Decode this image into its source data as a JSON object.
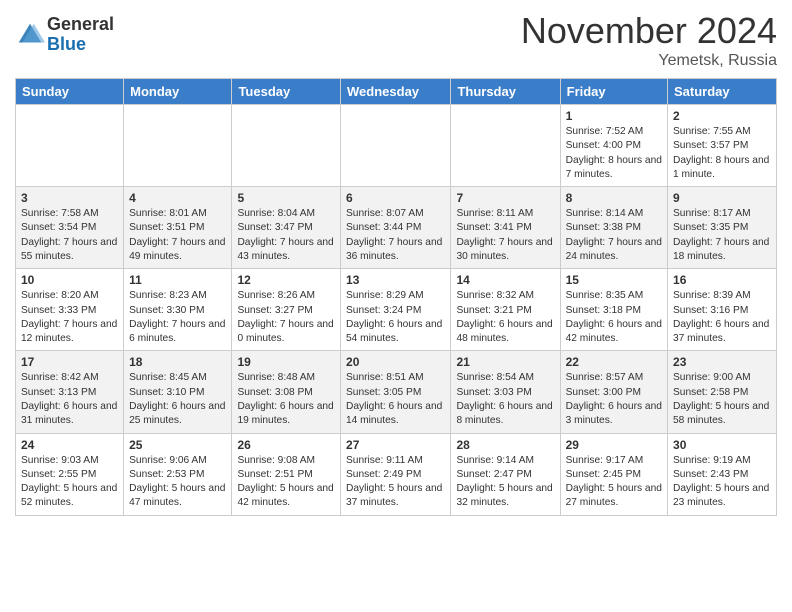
{
  "header": {
    "logo_general": "General",
    "logo_blue": "Blue",
    "month_title": "November 2024",
    "location": "Yemetsk, Russia"
  },
  "days_of_week": [
    "Sunday",
    "Monday",
    "Tuesday",
    "Wednesday",
    "Thursday",
    "Friday",
    "Saturday"
  ],
  "weeks": [
    [
      {
        "day": "",
        "sunrise": "",
        "sunset": "",
        "daylight": ""
      },
      {
        "day": "",
        "sunrise": "",
        "sunset": "",
        "daylight": ""
      },
      {
        "day": "",
        "sunrise": "",
        "sunset": "",
        "daylight": ""
      },
      {
        "day": "",
        "sunrise": "",
        "sunset": "",
        "daylight": ""
      },
      {
        "day": "",
        "sunrise": "",
        "sunset": "",
        "daylight": ""
      },
      {
        "day": "1",
        "sunrise": "Sunrise: 7:52 AM",
        "sunset": "Sunset: 4:00 PM",
        "daylight": "Daylight: 8 hours and 7 minutes."
      },
      {
        "day": "2",
        "sunrise": "Sunrise: 7:55 AM",
        "sunset": "Sunset: 3:57 PM",
        "daylight": "Daylight: 8 hours and 1 minute."
      }
    ],
    [
      {
        "day": "3",
        "sunrise": "Sunrise: 7:58 AM",
        "sunset": "Sunset: 3:54 PM",
        "daylight": "Daylight: 7 hours and 55 minutes."
      },
      {
        "day": "4",
        "sunrise": "Sunrise: 8:01 AM",
        "sunset": "Sunset: 3:51 PM",
        "daylight": "Daylight: 7 hours and 49 minutes."
      },
      {
        "day": "5",
        "sunrise": "Sunrise: 8:04 AM",
        "sunset": "Sunset: 3:47 PM",
        "daylight": "Daylight: 7 hours and 43 minutes."
      },
      {
        "day": "6",
        "sunrise": "Sunrise: 8:07 AM",
        "sunset": "Sunset: 3:44 PM",
        "daylight": "Daylight: 7 hours and 36 minutes."
      },
      {
        "day": "7",
        "sunrise": "Sunrise: 8:11 AM",
        "sunset": "Sunset: 3:41 PM",
        "daylight": "Daylight: 7 hours and 30 minutes."
      },
      {
        "day": "8",
        "sunrise": "Sunrise: 8:14 AM",
        "sunset": "Sunset: 3:38 PM",
        "daylight": "Daylight: 7 hours and 24 minutes."
      },
      {
        "day": "9",
        "sunrise": "Sunrise: 8:17 AM",
        "sunset": "Sunset: 3:35 PM",
        "daylight": "Daylight: 7 hours and 18 minutes."
      }
    ],
    [
      {
        "day": "10",
        "sunrise": "Sunrise: 8:20 AM",
        "sunset": "Sunset: 3:33 PM",
        "daylight": "Daylight: 7 hours and 12 minutes."
      },
      {
        "day": "11",
        "sunrise": "Sunrise: 8:23 AM",
        "sunset": "Sunset: 3:30 PM",
        "daylight": "Daylight: 7 hours and 6 minutes."
      },
      {
        "day": "12",
        "sunrise": "Sunrise: 8:26 AM",
        "sunset": "Sunset: 3:27 PM",
        "daylight": "Daylight: 7 hours and 0 minutes."
      },
      {
        "day": "13",
        "sunrise": "Sunrise: 8:29 AM",
        "sunset": "Sunset: 3:24 PM",
        "daylight": "Daylight: 6 hours and 54 minutes."
      },
      {
        "day": "14",
        "sunrise": "Sunrise: 8:32 AM",
        "sunset": "Sunset: 3:21 PM",
        "daylight": "Daylight: 6 hours and 48 minutes."
      },
      {
        "day": "15",
        "sunrise": "Sunrise: 8:35 AM",
        "sunset": "Sunset: 3:18 PM",
        "daylight": "Daylight: 6 hours and 42 minutes."
      },
      {
        "day": "16",
        "sunrise": "Sunrise: 8:39 AM",
        "sunset": "Sunset: 3:16 PM",
        "daylight": "Daylight: 6 hours and 37 minutes."
      }
    ],
    [
      {
        "day": "17",
        "sunrise": "Sunrise: 8:42 AM",
        "sunset": "Sunset: 3:13 PM",
        "daylight": "Daylight: 6 hours and 31 minutes."
      },
      {
        "day": "18",
        "sunrise": "Sunrise: 8:45 AM",
        "sunset": "Sunset: 3:10 PM",
        "daylight": "Daylight: 6 hours and 25 minutes."
      },
      {
        "day": "19",
        "sunrise": "Sunrise: 8:48 AM",
        "sunset": "Sunset: 3:08 PM",
        "daylight": "Daylight: 6 hours and 19 minutes."
      },
      {
        "day": "20",
        "sunrise": "Sunrise: 8:51 AM",
        "sunset": "Sunset: 3:05 PM",
        "daylight": "Daylight: 6 hours and 14 minutes."
      },
      {
        "day": "21",
        "sunrise": "Sunrise: 8:54 AM",
        "sunset": "Sunset: 3:03 PM",
        "daylight": "Daylight: 6 hours and 8 minutes."
      },
      {
        "day": "22",
        "sunrise": "Sunrise: 8:57 AM",
        "sunset": "Sunset: 3:00 PM",
        "daylight": "Daylight: 6 hours and 3 minutes."
      },
      {
        "day": "23",
        "sunrise": "Sunrise: 9:00 AM",
        "sunset": "Sunset: 2:58 PM",
        "daylight": "Daylight: 5 hours and 58 minutes."
      }
    ],
    [
      {
        "day": "24",
        "sunrise": "Sunrise: 9:03 AM",
        "sunset": "Sunset: 2:55 PM",
        "daylight": "Daylight: 5 hours and 52 minutes."
      },
      {
        "day": "25",
        "sunrise": "Sunrise: 9:06 AM",
        "sunset": "Sunset: 2:53 PM",
        "daylight": "Daylight: 5 hours and 47 minutes."
      },
      {
        "day": "26",
        "sunrise": "Sunrise: 9:08 AM",
        "sunset": "Sunset: 2:51 PM",
        "daylight": "Daylight: 5 hours and 42 minutes."
      },
      {
        "day": "27",
        "sunrise": "Sunrise: 9:11 AM",
        "sunset": "Sunset: 2:49 PM",
        "daylight": "Daylight: 5 hours and 37 minutes."
      },
      {
        "day": "28",
        "sunrise": "Sunrise: 9:14 AM",
        "sunset": "Sunset: 2:47 PM",
        "daylight": "Daylight: 5 hours and 32 minutes."
      },
      {
        "day": "29",
        "sunrise": "Sunrise: 9:17 AM",
        "sunset": "Sunset: 2:45 PM",
        "daylight": "Daylight: 5 hours and 27 minutes."
      },
      {
        "day": "30",
        "sunrise": "Sunrise: 9:19 AM",
        "sunset": "Sunset: 2:43 PM",
        "daylight": "Daylight: 5 hours and 23 minutes."
      }
    ]
  ]
}
